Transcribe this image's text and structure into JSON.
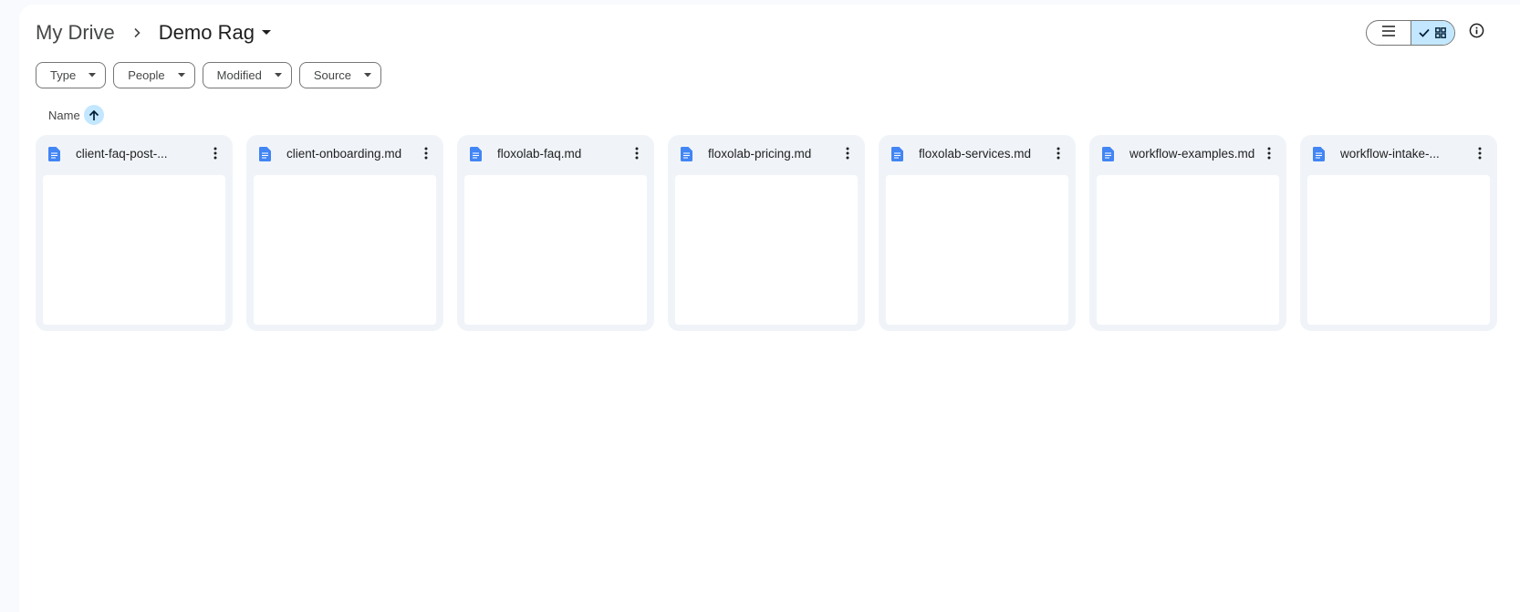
{
  "breadcrumb": {
    "root": "My Drive",
    "current": "Demo Rag"
  },
  "filters": [
    "Type",
    "People",
    "Modified",
    "Source"
  ],
  "sort": {
    "label": "Name",
    "direction": "ascending"
  },
  "files": [
    {
      "name": "client-faq-post-..."
    },
    {
      "name": "client-onboarding.md"
    },
    {
      "name": "floxolab-faq.md"
    },
    {
      "name": "floxolab-pricing.md"
    },
    {
      "name": "floxolab-services.md"
    },
    {
      "name": "workflow-examples.md"
    },
    {
      "name": "workflow-intake-..."
    }
  ],
  "view": {
    "selected": "grid"
  },
  "colors": {
    "accent": "#c2e7ff",
    "doc_icon": "#4285f4",
    "card_bg": "#f0f4f9"
  }
}
